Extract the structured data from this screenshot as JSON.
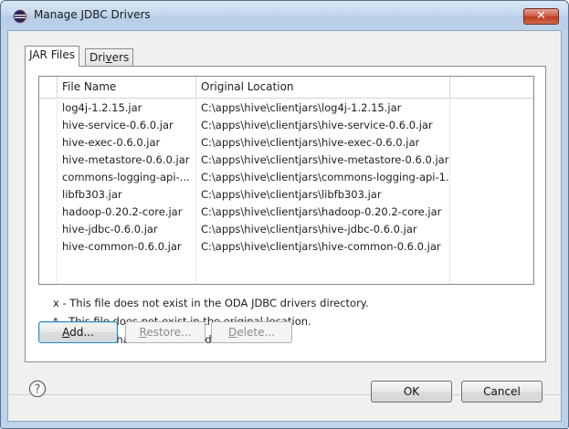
{
  "window": {
    "title": "Manage JDBC Drivers",
    "close_glyph": "✕"
  },
  "tabs": [
    {
      "label_mnemonic": "J",
      "label_rest": "AR Files",
      "active": true
    },
    {
      "label_pre": "Dri",
      "label_mnemonic": "v",
      "label_rest": "ers",
      "active": false
    }
  ],
  "table": {
    "columns": [
      "File Name",
      "Original Location"
    ],
    "rows": [
      {
        "file": "log4j-1.2.15.jar",
        "location": "C:\\apps\\hive\\clientjars\\log4j-1.2.15.jar"
      },
      {
        "file": "hive-service-0.6.0.jar",
        "location": "C:\\apps\\hive\\clientjars\\hive-service-0.6.0.jar"
      },
      {
        "file": "hive-exec-0.6.0.jar",
        "location": "C:\\apps\\hive\\clientjars\\hive-exec-0.6.0.jar"
      },
      {
        "file": "hive-metastore-0.6.0.jar",
        "location": "C:\\apps\\hive\\clientjars\\hive-metastore-0.6.0.jar"
      },
      {
        "file": "commons-logging-api-...",
        "location": "C:\\apps\\hive\\clientjars\\commons-logging-api-1..."
      },
      {
        "file": "libfb303.jar",
        "location": "C:\\apps\\hive\\clientjars\\libfb303.jar"
      },
      {
        "file": "hadoop-0.20.2-core.jar",
        "location": "C:\\apps\\hive\\clientjars\\hadoop-0.20.2-core.jar"
      },
      {
        "file": "hive-jdbc-0.6.0.jar",
        "location": "C:\\apps\\hive\\clientjars\\hive-jdbc-0.6.0.jar"
      },
      {
        "file": "hive-common-0.6.0.jar",
        "location": "C:\\apps\\hive\\clientjars\\hive-common-0.6.0.jar"
      }
    ]
  },
  "legend": [
    "x - This file does not exist in the ODA JDBC drivers directory.",
    "* - This file does not exist in the original location.",
    "+ - This file has been restored."
  ],
  "actions": {
    "add": {
      "mnemonic": "A",
      "rest": "dd..."
    },
    "restore": {
      "mnemonic": "R",
      "rest": "estore..."
    },
    "delete": {
      "mnemonic": "D",
      "rest": "elete..."
    }
  },
  "footer": {
    "help_glyph": "?",
    "ok_label": "OK",
    "cancel_label": "Cancel"
  },
  "icons": {
    "title": "eclipse-icon",
    "help": "help-icon"
  }
}
